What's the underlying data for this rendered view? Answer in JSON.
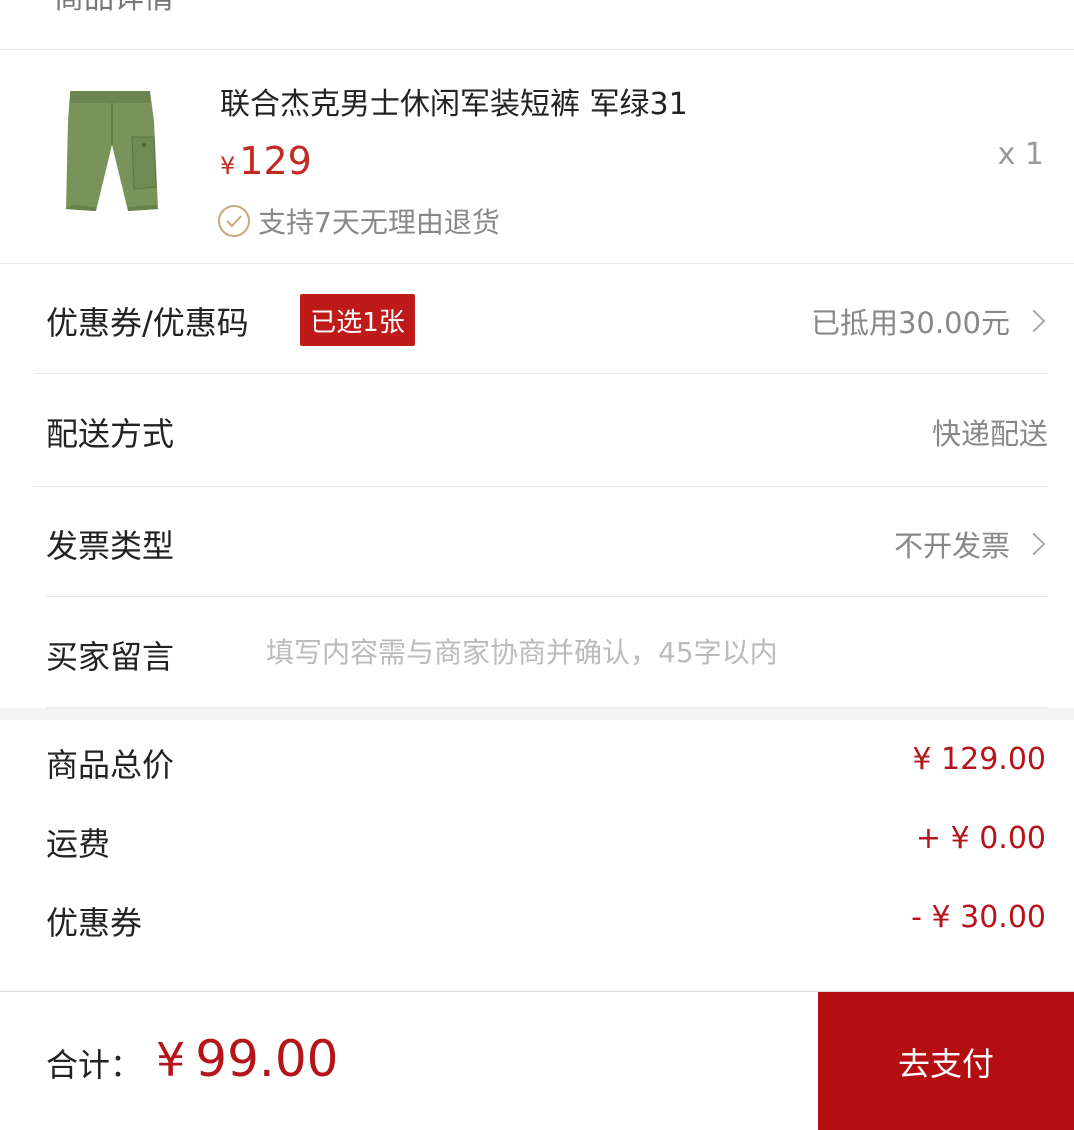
{
  "header": {
    "title": "商品详情"
  },
  "product": {
    "name": "联合杰克男士休闲军装短裤 军绿31",
    "currency": "¥",
    "price": "129",
    "quantity": "x 1",
    "return_policy": "支持7天无理由退货",
    "image_icon": "shorts-thumbnail"
  },
  "options": {
    "coupon": {
      "label": "优惠券/优惠码",
      "badge": "已选1张",
      "value": "已抵用30.00元"
    },
    "delivery": {
      "label": "配送方式",
      "value": "快递配送"
    },
    "invoice": {
      "label": "发票类型",
      "value": "不开发票"
    },
    "message": {
      "label": "买家留言",
      "placeholder": "填写内容需与商家协商并确认，45字以内",
      "value": ""
    }
  },
  "summary": {
    "subtotal": {
      "label": "商品总价",
      "value": "¥ 129.00"
    },
    "shipping": {
      "label": "运费",
      "value": "+ ¥ 0.00"
    },
    "coupon": {
      "label": "优惠券",
      "value": "- ¥ 30.00"
    }
  },
  "footer": {
    "total_label": "合计：",
    "currency": "¥",
    "total_amount": "99.00",
    "pay_label": "去支付"
  },
  "colors": {
    "accent": "#b40e11",
    "price": "#c22a24",
    "badge": "#be1a1a",
    "check": "#c7a97a"
  }
}
